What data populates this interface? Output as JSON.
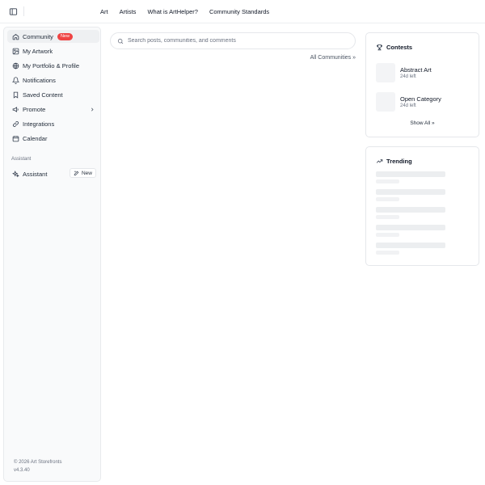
{
  "topnav": {
    "items": [
      "Art",
      "Artists",
      "What is ArtHelper?",
      "Community Standards"
    ]
  },
  "sidebar": {
    "items": [
      {
        "label": "Community",
        "icon": "home-icon",
        "badge": "New",
        "active": true
      },
      {
        "label": "My Artwork",
        "icon": "image-icon"
      },
      {
        "label": "My Portfolio & Profile",
        "icon": "globe-icon"
      },
      {
        "label": "Notifications",
        "icon": "bell-icon"
      },
      {
        "label": "Saved Content",
        "icon": "bookmark-icon"
      },
      {
        "label": "Promote",
        "icon": "megaphone-icon",
        "has_submenu": true
      },
      {
        "label": "Integrations",
        "icon": "link-icon"
      },
      {
        "label": "Calendar",
        "icon": "calendar-icon"
      }
    ],
    "assistant_section": {
      "title": "Assistant",
      "item_label": "Assistant",
      "item_icon": "sparkles-icon",
      "new_button_label": "New"
    },
    "footer": {
      "copyright": "© 2026 Art Storefronts",
      "version": "v4.3.40"
    }
  },
  "main": {
    "search": {
      "placeholder": "Search posts, communities, and comments",
      "value": ""
    },
    "all_communities_link": "All Communities »"
  },
  "contests": {
    "title": "Contests",
    "icon": "trophy-icon",
    "items": [
      {
        "name": "Abstract Art",
        "time_left": "24d left"
      },
      {
        "name": "Open Category",
        "time_left": "24d left"
      }
    ],
    "show_all": "Show All »"
  },
  "trending": {
    "title": "Trending",
    "icon": "trending-up-icon",
    "loading_placeholders": 5
  },
  "colors": {
    "badge": "#ef4444",
    "sidebar_bg": "#f9fafb",
    "border": "#e5e7eb",
    "skeleton": "#eceef0"
  }
}
